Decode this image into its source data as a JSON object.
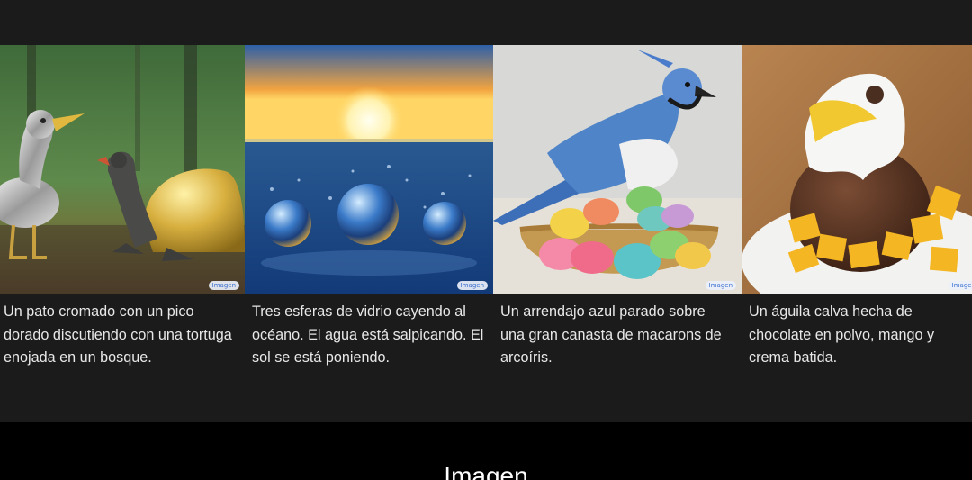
{
  "gallery": {
    "badge_label": "Imagen",
    "cards": [
      {
        "image": "chrome-duck-and-golden-turtle-image",
        "caption": "Un pato cromado con un pico dorado discutiendo con una tortuga enojada en un bosque."
      },
      {
        "image": "glass-spheres-ocean-sunset-image",
        "caption": "Tres esferas de vidrio cayendo al océano. El agua está salpicando. El sol se está poniendo."
      },
      {
        "image": "blue-jay-on-macarons-basket-image",
        "caption": "Un arrendajo azul parado sobre una gran canasta de macarons de arcoíris."
      },
      {
        "image": "chocolate-mango-eagle-image",
        "caption": "Un águila calva hecha de chocolate en polvo, mango y crema batida."
      }
    ]
  },
  "footer": {
    "title": "Imagen"
  },
  "colors": {
    "background": "#1b1b1b",
    "footer": "#000000",
    "text": "#e8e8e8",
    "badge_text": "#3a6fd0"
  }
}
